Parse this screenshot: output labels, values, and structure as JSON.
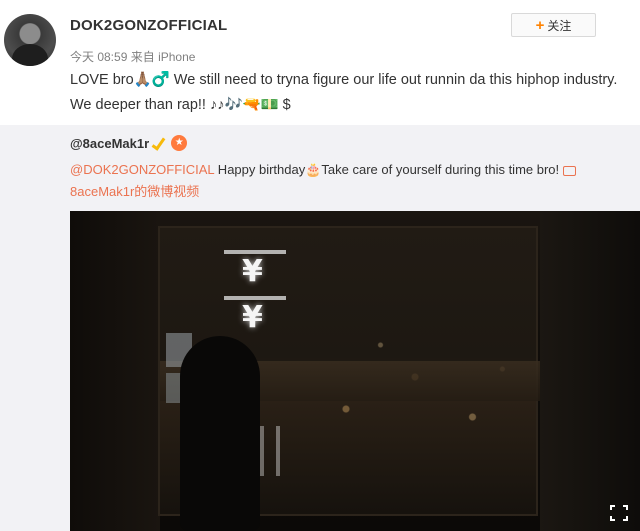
{
  "post": {
    "username": "DOK2GONZOFFICIAL",
    "time": "今天 08:59",
    "via": "来自",
    "device": "iPhone",
    "follow_label": "关注",
    "text": "LOVE bro🙏🏽♂️ We still need to tryna figure our life out runnin da this hiphop industry. We deeper than rap!! ♪♪🎶🔫💵 $"
  },
  "repost": {
    "author": "@8aceMak1r",
    "mention": "@DOK2GONZOFFICIAL",
    "text": " Happy birthday🎂Take care of yourself during this time bro!",
    "video_link": "8aceMak1r的微博视频"
  },
  "icons": {
    "verified": "verified-v-icon",
    "badge": "fan-badge-icon",
    "video": "video-icon",
    "fullscreen": "fullscreen-icon",
    "follow_plus": "plus-icon"
  },
  "colors": {
    "accent": "#eb7350",
    "follow_plus": "#ff8200",
    "verified": "#f7ba0b",
    "repost_bg": "#f2f2f5"
  }
}
